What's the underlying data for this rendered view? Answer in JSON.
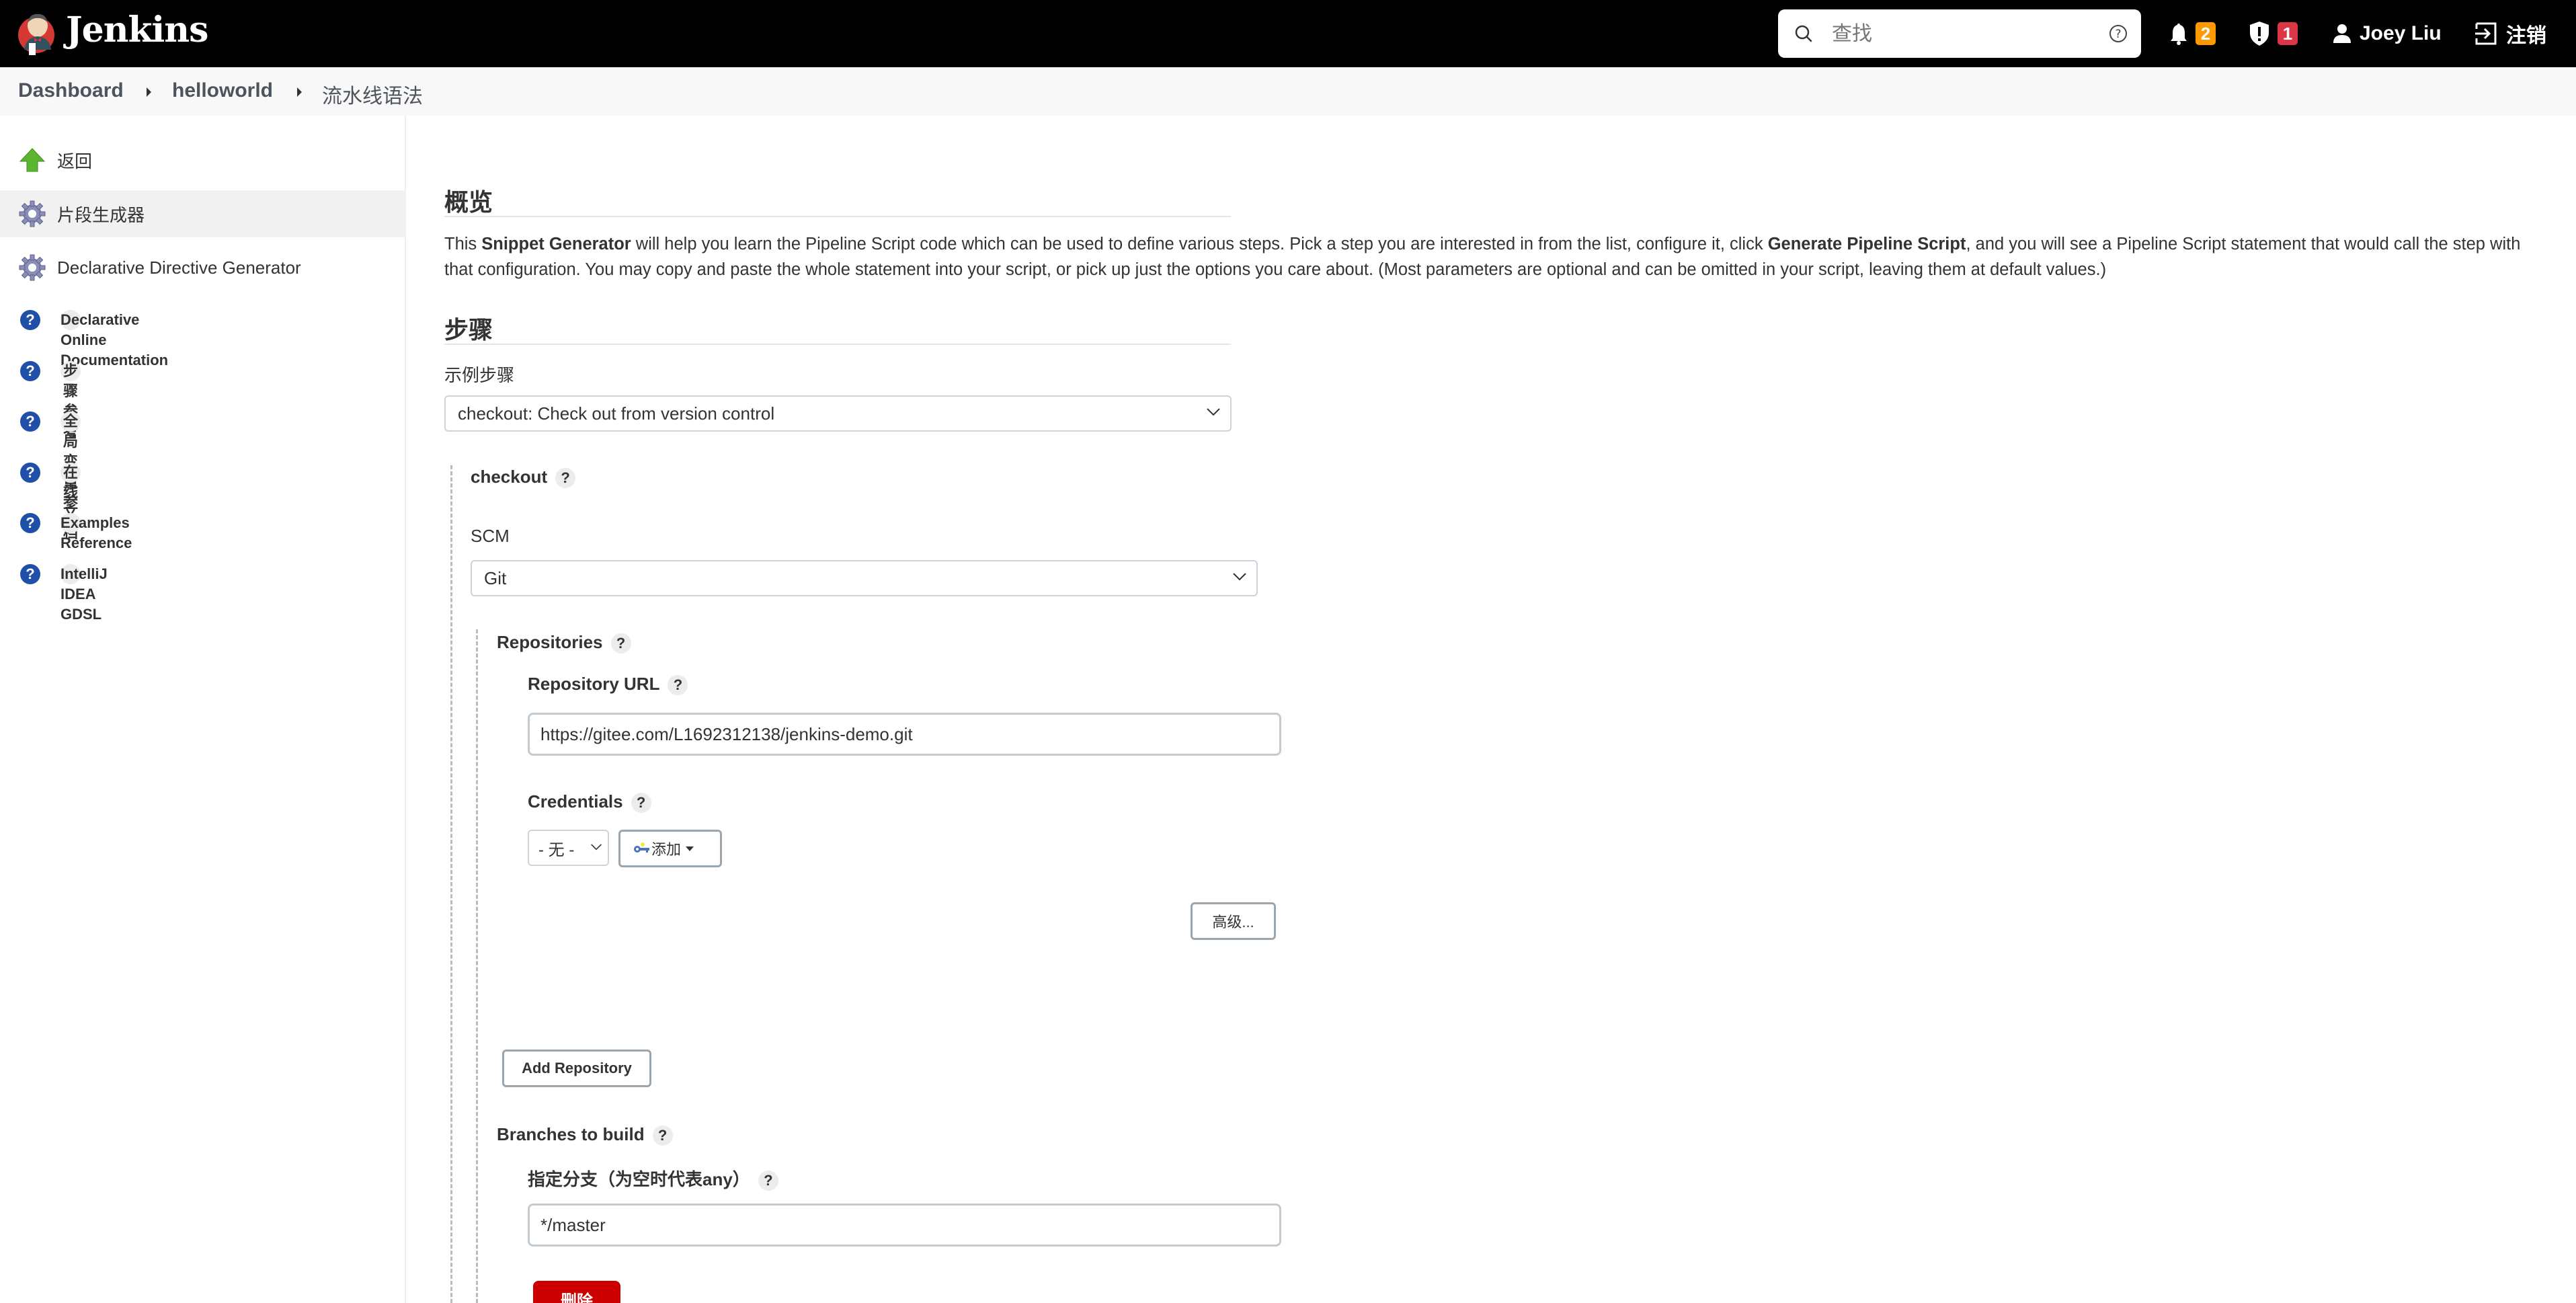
{
  "header": {
    "brand": "Jenkins",
    "search_placeholder": "查找",
    "notifications_count": "2",
    "security_count": "1",
    "user_name": "Joey Liu",
    "logout_label": "注销",
    "colors": {
      "notifications_badge": "#ff9900",
      "security_badge": "#dc3545"
    }
  },
  "breadcrumb": {
    "items": [
      "Dashboard",
      "helloworld",
      "流水线语法"
    ]
  },
  "sidebar": {
    "items": [
      {
        "label": "返回",
        "icon": "up-arrow-icon"
      },
      {
        "label": "片段生成器",
        "icon": "gear-icon",
        "active": true
      },
      {
        "label": "Declarative Directive Generator",
        "icon": "gear-icon"
      },
      {
        "label": "Declarative Online Documentation",
        "icon": "help-icon"
      },
      {
        "label": "步骤参考",
        "icon": "help-icon"
      },
      {
        "label": "全局变量参考",
        "icon": "help-icon"
      },
      {
        "label": "在线文档",
        "icon": "help-icon"
      },
      {
        "label": "Examples Reference",
        "icon": "help-icon"
      },
      {
        "label": "IntelliJ IDEA GDSL",
        "icon": "help-icon"
      }
    ]
  },
  "overview": {
    "heading": "概览",
    "text_1": "This ",
    "bold_1": "Snippet Generator",
    "text_2": " will help you learn the Pipeline Script code which can be used to define various steps. Pick a step you are interested in from the list, configure it, click ",
    "bold_2": "Generate Pipeline Script",
    "text_3": ", and you will see a Pipeline Script statement that would call the step with that configuration. You may copy and paste the whole statement into your script, or pick up just the options you care about. (Most parameters are optional and can be omitted in your script, leaving them at default values.)"
  },
  "steps": {
    "heading": "步骤",
    "sample_step_label": "示例步骤",
    "sample_step_value": "checkout: Check out from version control",
    "checkout_label": "checkout",
    "scm_label": "SCM",
    "scm_value": "Git",
    "repositories_label": "Repositories",
    "repo_url_label": "Repository URL",
    "repo_url_value": "https://gitee.com/L1692312138/jenkins-demo.git",
    "credentials_label": "Credentials",
    "credentials_value": "- 无 -",
    "add_credentials_label": "添加",
    "advanced_label": "高级...",
    "add_repository_label": "Add Repository",
    "branches_label": "Branches to build",
    "branch_spec_label": "指定分支（为空时代表any）",
    "branch_spec_value": "*/master",
    "delete_label": "删除",
    "help_glyph": "?"
  }
}
